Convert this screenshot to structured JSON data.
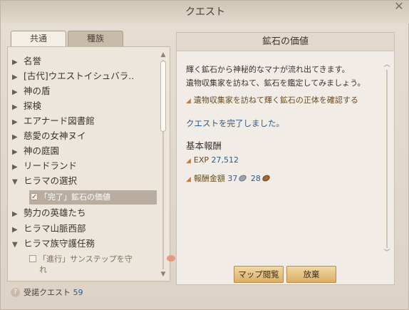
{
  "window": {
    "title": "クエスト"
  },
  "tabs": [
    {
      "label": "共通",
      "active": true
    },
    {
      "label": "種族",
      "active": false
    }
  ],
  "quest_list": {
    "items": [
      {
        "label": "名誉",
        "expanded": false
      },
      {
        "label": "[古代]ウエストイシュバラ..",
        "expanded": false
      },
      {
        "label": "神の盾",
        "expanded": false
      },
      {
        "label": "探検",
        "expanded": false
      },
      {
        "label": "エアナード図書館",
        "expanded": false
      },
      {
        "label": "慈愛の女神ヌイ",
        "expanded": false
      },
      {
        "label": "神の庭園",
        "expanded": false
      },
      {
        "label": "リードランド",
        "expanded": false
      },
      {
        "label": "ヒラマの選択",
        "expanded": true
      },
      {
        "label": "勢力の英雄たち",
        "expanded": false
      },
      {
        "label": "ヒラマ山脈西部",
        "expanded": false
      },
      {
        "label": "ヒラマ族守護任務",
        "expanded": true
      }
    ],
    "sub_items": [
      {
        "label": "「完了」鉱石の価値",
        "checked": true,
        "selected": true
      },
      {
        "label": "「進行」サンステップを守",
        "label2": "れ",
        "checked": false,
        "selected": false
      }
    ]
  },
  "detail": {
    "title": "鉱石の価値",
    "description_line1": "輝く鉱石から神秘的なマナが流れ出てきます。",
    "description_line2": "遺物収集家を訪ねて、鉱石を鑑定してみましょう。",
    "objective": "遺物収集家を訪ねて輝く鉱石の正体を確認する",
    "completed_text": "クエストを完了しました。",
    "reward_title": "基本報酬",
    "exp_label": "EXP",
    "exp_value": "27,512",
    "money_label": "報酬金額",
    "silver_value": "37",
    "bronze_value": "28",
    "map_button": "マップ閲覧",
    "abandon_button": "放棄"
  },
  "footer": {
    "label": "受諾クエスト",
    "count": "59"
  },
  "colors": {
    "accent_blue": "#2f5b8a",
    "button_gold": "#d9ae66",
    "selected_row": "#b9ada0"
  }
}
